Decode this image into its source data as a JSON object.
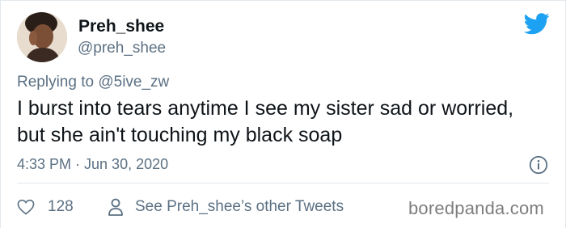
{
  "user": {
    "display_name": "Preh_shee",
    "handle": "@preh_shee"
  },
  "reply": {
    "prefix": "Replying to ",
    "mention": "@5ive_zw"
  },
  "tweet": {
    "text": "I burst into tears anytime I see my sister sad or worried, but she ain't touching my black soap",
    "timestamp": "4:33 PM · Jun 30, 2020"
  },
  "actions": {
    "likes_count": "128",
    "see_other_label": "See Preh_shee’s other Tweets"
  },
  "watermark": "boredpanda.com",
  "icons": {
    "brand": "twitter-bird-icon",
    "info": "info-icon",
    "like": "heart-icon",
    "profile": "person-icon"
  },
  "colors": {
    "brand_blue": "#1da1f2",
    "secondary_text": "#5b7083",
    "primary_text": "#0f1419"
  }
}
